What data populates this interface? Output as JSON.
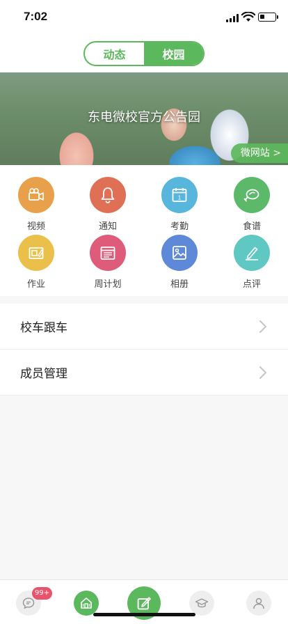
{
  "status_bar": {
    "time": "7:02",
    "battery_level": 0.3
  },
  "header": {
    "tabs": [
      {
        "label": "动态",
        "active": false
      },
      {
        "label": "校园",
        "active": true
      }
    ]
  },
  "banner": {
    "title": "东电微校官方公告园",
    "link_label": "微网站 >"
  },
  "grid": {
    "items": [
      {
        "label": "视频",
        "icon": "video-camera-icon",
        "color": "#E9A04A"
      },
      {
        "label": "通知",
        "icon": "bell-icon",
        "color": "#E07055"
      },
      {
        "label": "考勤",
        "icon": "calendar-icon",
        "color": "#58B5DB"
      },
      {
        "label": "食谱",
        "icon": "chicken-leg-icon",
        "color": "#5DB96A"
      },
      {
        "label": "作业",
        "icon": "homework-icon",
        "color": "#EAC04A"
      },
      {
        "label": "周计划",
        "icon": "weekly-plan-icon",
        "color": "#DE5B79"
      },
      {
        "label": "相册",
        "icon": "photo-album-icon",
        "color": "#5E88D8"
      },
      {
        "label": "点评",
        "icon": "pencil-icon",
        "color": "#5FC8C2"
      }
    ]
  },
  "list": {
    "items": [
      {
        "label": "校车跟车"
      },
      {
        "label": "成员管理"
      }
    ]
  },
  "tabbar": {
    "badge": "99+",
    "tabs": [
      {
        "icon": "chat-icon",
        "color": "#eeeeee"
      },
      {
        "icon": "school-home-icon",
        "color": "#5cb85c"
      },
      {
        "icon": "compose-icon",
        "color": "#5cb85c"
      },
      {
        "icon": "graduation-cap-icon",
        "color": "#eeeeee"
      },
      {
        "icon": "profile-icon",
        "color": "#eeeeee"
      }
    ]
  },
  "colors": {
    "accent": "#5cb85c"
  }
}
